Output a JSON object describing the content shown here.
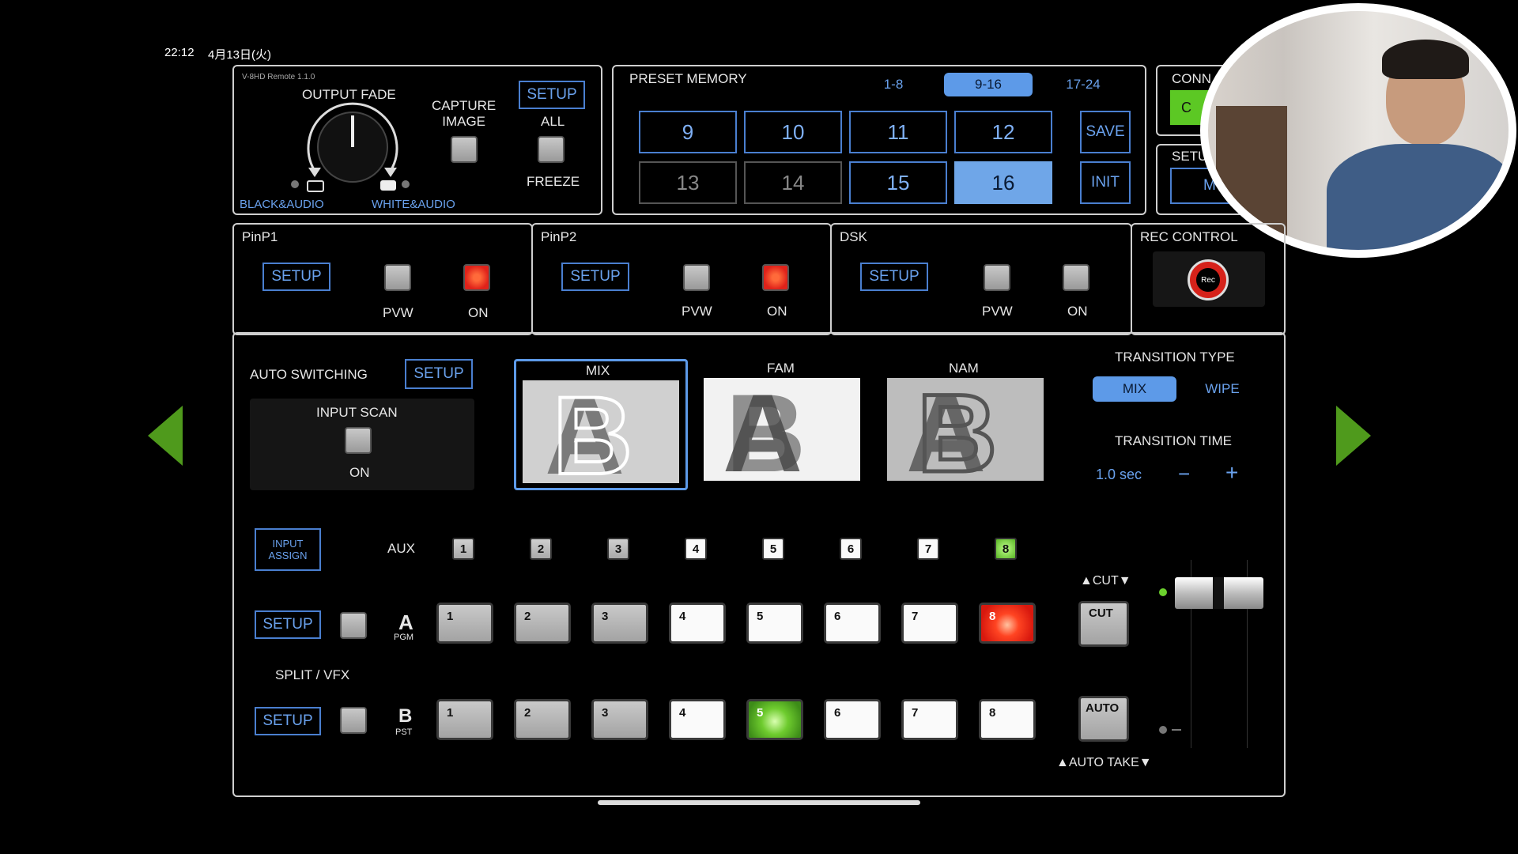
{
  "status_bar": {
    "time": "22:12",
    "date": "4月13日(火)"
  },
  "app_version": "V-8HD Remote 1.1.0",
  "output_fade": {
    "title": "OUTPUT FADE",
    "left_label": "BLACK&AUDIO",
    "right_label": "WHITE&AUDIO",
    "capture_label": "CAPTURE\nIMAGE",
    "setup_label": "SETUP",
    "all_label": "ALL",
    "freeze_label": "FREEZE"
  },
  "preset_memory": {
    "title": "PRESET MEMORY",
    "banks": [
      "1-8",
      "9-16",
      "17-24"
    ],
    "selected_bank": "9-16",
    "presets": [
      "9",
      "10",
      "11",
      "12",
      "13",
      "14",
      "15",
      "16"
    ],
    "selected_preset": "16",
    "save_label": "SAVE",
    "init_label": "INIT"
  },
  "connection": {
    "title": "CONN",
    "button_label": "C"
  },
  "setup_partial": {
    "title": "SETU",
    "button_label": "M"
  },
  "pinp1": {
    "title": "PinP1",
    "setup_label": "SETUP",
    "pvw_label": "PVW",
    "on_label": "ON"
  },
  "pinp2": {
    "title": "PinP2",
    "setup_label": "SETUP",
    "pvw_label": "PVW",
    "on_label": "ON"
  },
  "dsk": {
    "title": "DSK",
    "setup_label": "SETUP",
    "pvw_label": "PVW",
    "on_label": "ON"
  },
  "rec_control": {
    "title": "REC CONTROL",
    "rec_label": "Rec"
  },
  "auto_switching": {
    "title": "AUTO SWITCHING",
    "setup_label": "SETUP",
    "input_scan_label": "INPUT SCAN",
    "on_label": "ON"
  },
  "mix_modes": [
    {
      "label": "MIX",
      "selected": true
    },
    {
      "label": "FAM",
      "selected": false
    },
    {
      "label": "NAM",
      "selected": false
    }
  ],
  "transition": {
    "type_title": "TRANSITION TYPE",
    "types": [
      "MIX",
      "WIPE"
    ],
    "selected_type": "MIX",
    "time_title": "TRANSITION TIME",
    "time_value": "1.0 sec",
    "minus": "−",
    "plus": "+"
  },
  "input_assign_label": "INPUT\nASSIGN",
  "aux": {
    "label": "AUX",
    "buttons": [
      "1",
      "2",
      "3",
      "4",
      "5",
      "6",
      "7",
      "8"
    ],
    "active": "8"
  },
  "bus_a": {
    "letter": "A",
    "sub": "PGM",
    "setup_label": "SETUP",
    "buttons": [
      "1",
      "2",
      "3",
      "4",
      "5",
      "6",
      "7",
      "8"
    ],
    "active": "8"
  },
  "split_vfx_label": "SPLIT / VFX",
  "bus_b": {
    "letter": "B",
    "sub": "PST",
    "setup_label": "SETUP",
    "buttons": [
      "1",
      "2",
      "3",
      "4",
      "5",
      "6",
      "7",
      "8"
    ],
    "active": "5"
  },
  "cut": {
    "title": "▲CUT▼",
    "button_label": "CUT"
  },
  "auto": {
    "button_label": "AUTO",
    "title": "▲AUTO TAKE▼"
  },
  "colors": {
    "accent_blue": "#4a7fd0",
    "pgm_red": "#e0221a",
    "pst_green": "#59b524",
    "nav_green": "#4f9a1c"
  }
}
